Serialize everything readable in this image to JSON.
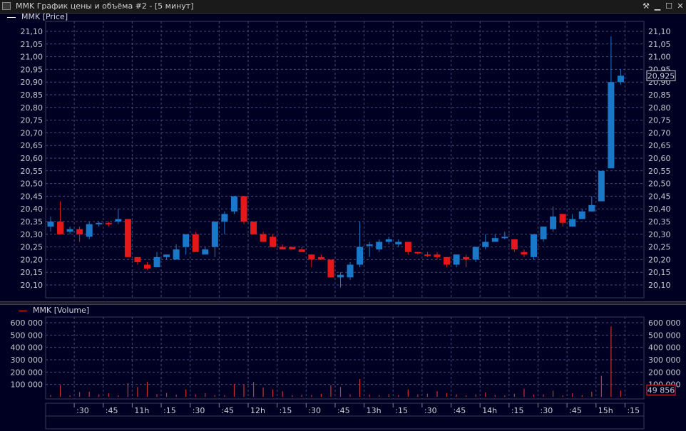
{
  "window": {
    "title": "MMK График цены и объёма #2 - [5 минут]",
    "buttons": {
      "pin": "⚒",
      "minimize": "▁",
      "maximize": "☐",
      "close": "✕"
    }
  },
  "price_panel": {
    "legend": "MMK [Price]",
    "legend_color": "#ffffff",
    "last_price": "20,925"
  },
  "volume_panel": {
    "legend": "MMK [Volume]",
    "legend_color": "#e03030",
    "last_volume": "49 856"
  },
  "colors": {
    "up": "#1a78c8",
    "down": "#e41818",
    "grid": "#4a4a78",
    "volume_bar": "#c83232"
  },
  "chart_data": [
    {
      "type": "candlestick",
      "title": "MMK [Price]",
      "interval": "5 минут",
      "ylim": [
        20.05,
        21.1
      ],
      "y_ticks": [
        "21,10",
        "21,05",
        "21,00",
        "20,95",
        "20,90",
        "20,85",
        "20,80",
        "20,75",
        "20,70",
        "20,65",
        "20,60",
        "20,55",
        "20,50",
        "20,45",
        "20,40",
        "20,35",
        "20,30",
        "20,25",
        "20,20",
        "20,15",
        "20,10"
      ],
      "candles": [
        {
          "o": 20.33,
          "h": 20.37,
          "l": 20.31,
          "c": 20.35
        },
        {
          "o": 20.35,
          "h": 20.43,
          "l": 20.3,
          "c": 20.3
        },
        {
          "o": 20.31,
          "h": 20.33,
          "l": 20.3,
          "c": 20.32
        },
        {
          "o": 20.32,
          "h": 20.33,
          "l": 20.27,
          "c": 20.3
        },
        {
          "o": 20.29,
          "h": 20.35,
          "l": 20.28,
          "c": 20.34
        },
        {
          "o": 20.34,
          "h": 20.35,
          "l": 20.33,
          "c": 20.345
        },
        {
          "o": 20.345,
          "h": 20.35,
          "l": 20.33,
          "c": 20.34
        },
        {
          "o": 20.35,
          "h": 20.4,
          "l": 20.34,
          "c": 20.36
        },
        {
          "o": 20.36,
          "h": 20.36,
          "l": 20.21,
          "c": 20.21
        },
        {
          "o": 20.21,
          "h": 20.21,
          "l": 20.18,
          "c": 20.19
        },
        {
          "o": 20.18,
          "h": 20.19,
          "l": 20.16,
          "c": 20.165
        },
        {
          "o": 20.17,
          "h": 20.23,
          "l": 20.17,
          "c": 20.21
        },
        {
          "o": 20.21,
          "h": 20.22,
          "l": 20.2,
          "c": 20.22
        },
        {
          "o": 20.2,
          "h": 20.26,
          "l": 20.2,
          "c": 20.24
        },
        {
          "o": 20.25,
          "h": 20.3,
          "l": 20.22,
          "c": 20.3
        },
        {
          "o": 20.3,
          "h": 20.31,
          "l": 20.23,
          "c": 20.23
        },
        {
          "o": 20.22,
          "h": 20.25,
          "l": 20.22,
          "c": 20.24
        },
        {
          "o": 20.25,
          "h": 20.35,
          "l": 20.21,
          "c": 20.35
        },
        {
          "o": 20.35,
          "h": 20.39,
          "l": 20.3,
          "c": 20.38
        },
        {
          "o": 20.39,
          "h": 20.45,
          "l": 20.38,
          "c": 20.45
        },
        {
          "o": 20.45,
          "h": 20.45,
          "l": 20.34,
          "c": 20.35
        },
        {
          "o": 20.35,
          "h": 20.35,
          "l": 20.3,
          "c": 20.3
        },
        {
          "o": 20.3,
          "h": 20.31,
          "l": 20.27,
          "c": 20.27
        },
        {
          "o": 20.29,
          "h": 20.3,
          "l": 20.25,
          "c": 20.25
        },
        {
          "o": 20.25,
          "h": 20.26,
          "l": 20.24,
          "c": 20.24
        },
        {
          "o": 20.25,
          "h": 20.25,
          "l": 20.24,
          "c": 20.24
        },
        {
          "o": 20.24,
          "h": 20.25,
          "l": 20.23,
          "c": 20.23
        },
        {
          "o": 20.22,
          "h": 20.22,
          "l": 20.17,
          "c": 20.2
        },
        {
          "o": 20.21,
          "h": 20.22,
          "l": 20.2,
          "c": 20.2
        },
        {
          "o": 20.2,
          "h": 20.2,
          "l": 20.13,
          "c": 20.13
        },
        {
          "o": 20.13,
          "h": 20.15,
          "l": 20.09,
          "c": 20.14
        },
        {
          "o": 20.13,
          "h": 20.19,
          "l": 20.12,
          "c": 20.18
        },
        {
          "o": 20.18,
          "h": 20.35,
          "l": 20.17,
          "c": 20.25
        },
        {
          "o": 20.255,
          "h": 20.27,
          "l": 20.21,
          "c": 20.26
        },
        {
          "o": 20.24,
          "h": 20.28,
          "l": 20.23,
          "c": 20.27
        },
        {
          "o": 20.27,
          "h": 20.29,
          "l": 20.26,
          "c": 20.28
        },
        {
          "o": 20.26,
          "h": 20.28,
          "l": 20.25,
          "c": 20.27
        },
        {
          "o": 20.27,
          "h": 20.27,
          "l": 20.22,
          "c": 20.23
        },
        {
          "o": 20.23,
          "h": 20.23,
          "l": 20.22,
          "c": 20.225
        },
        {
          "o": 20.22,
          "h": 20.23,
          "l": 20.21,
          "c": 20.215
        },
        {
          "o": 20.22,
          "h": 20.23,
          "l": 20.2,
          "c": 20.21
        },
        {
          "o": 20.21,
          "h": 20.21,
          "l": 20.17,
          "c": 20.18
        },
        {
          "o": 20.18,
          "h": 20.22,
          "l": 20.17,
          "c": 20.22
        },
        {
          "o": 20.21,
          "h": 20.22,
          "l": 20.17,
          "c": 20.2
        },
        {
          "o": 20.2,
          "h": 20.25,
          "l": 20.19,
          "c": 20.25
        },
        {
          "o": 20.25,
          "h": 20.3,
          "l": 20.24,
          "c": 20.27
        },
        {
          "o": 20.27,
          "h": 20.3,
          "l": 20.27,
          "c": 20.285
        },
        {
          "o": 20.285,
          "h": 20.31,
          "l": 20.28,
          "c": 20.29
        },
        {
          "o": 20.28,
          "h": 20.28,
          "l": 20.23,
          "c": 20.24
        },
        {
          "o": 20.23,
          "h": 20.24,
          "l": 20.21,
          "c": 20.22
        },
        {
          "o": 20.21,
          "h": 20.3,
          "l": 20.2,
          "c": 20.3
        },
        {
          "o": 20.28,
          "h": 20.33,
          "l": 20.27,
          "c": 20.33
        },
        {
          "o": 20.32,
          "h": 20.41,
          "l": 20.31,
          "c": 20.37
        },
        {
          "o": 20.38,
          "h": 20.38,
          "l": 20.33,
          "c": 20.345
        },
        {
          "o": 20.33,
          "h": 20.38,
          "l": 20.33,
          "c": 20.36
        },
        {
          "o": 20.36,
          "h": 20.4,
          "l": 20.36,
          "c": 20.39
        },
        {
          "o": 20.39,
          "h": 20.45,
          "l": 20.39,
          "c": 20.415
        },
        {
          "o": 20.43,
          "h": 20.55,
          "l": 20.43,
          "c": 20.55
        },
        {
          "o": 20.56,
          "h": 21.08,
          "l": 20.56,
          "c": 20.9
        },
        {
          "o": 20.9,
          "h": 20.95,
          "l": 20.89,
          "c": 20.925
        }
      ]
    },
    {
      "type": "bar",
      "title": "MMK [Volume]",
      "ylim": [
        0,
        600000
      ],
      "y_ticks": [
        "600 000",
        "500 000",
        "400 000",
        "300 000",
        "200 000",
        "100 000"
      ],
      "values": [
        15000,
        95000,
        12000,
        38000,
        42000,
        20000,
        28000,
        12000,
        110000,
        80000,
        122000,
        22000,
        32000,
        18000,
        60000,
        20000,
        30000,
        15000,
        14000,
        105000,
        98000,
        120000,
        75000,
        60000,
        45000,
        14000,
        18000,
        15000,
        25000,
        95000,
        80000,
        20000,
        145000,
        18000,
        15000,
        22000,
        15000,
        60000,
        20000,
        25000,
        45000,
        30000,
        20000,
        12000,
        20000,
        35000,
        15000,
        12000,
        25000,
        65000,
        18000,
        20000,
        50000,
        12000,
        28000,
        14000,
        40000,
        170000,
        570000,
        49856
      ]
    }
  ],
  "time_axis": {
    "labels": [
      ":30",
      ":45",
      "11h",
      ":15",
      ":30",
      ":45",
      "12h",
      ":15",
      ":30",
      ":45",
      "13h",
      ":15",
      ":30",
      ":45",
      "14h",
      ":15",
      ":30",
      ":45",
      "15h",
      ":15"
    ]
  }
}
